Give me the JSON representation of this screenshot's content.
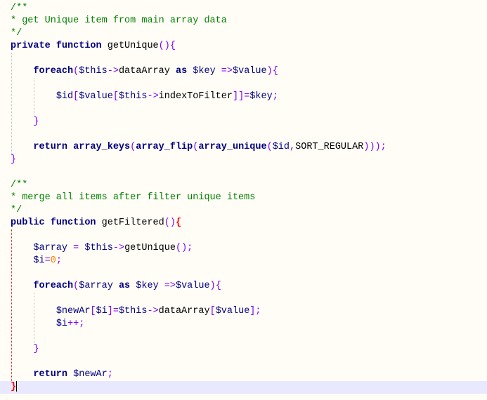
{
  "colors": {
    "background": "#fffdf6",
    "comment": "#008000",
    "keyword": "#000080",
    "operator": "#8000ff",
    "number": "#ff8000",
    "brace_match": "#ff0000",
    "current_line": "#e8e8ff"
  },
  "current_line": 30,
  "lines": [
    [
      [
        "c",
        "/**"
      ]
    ],
    [
      [
        "c",
        "* get Unique item from main array data"
      ]
    ],
    [
      [
        "c",
        "*/"
      ]
    ],
    [
      [
        "k",
        "private"
      ],
      [
        "f",
        " "
      ],
      [
        "k",
        "function"
      ],
      [
        "f",
        " getUnique"
      ],
      [
        "o",
        "(){"
      ]
    ],
    [],
    [
      [
        "f",
        "    "
      ],
      [
        "k",
        "foreach"
      ],
      [
        "o",
        "("
      ],
      [
        "v",
        "$this"
      ],
      [
        "o",
        "->"
      ],
      [
        "f",
        "dataArray "
      ],
      [
        "k",
        "as"
      ],
      [
        "f",
        " "
      ],
      [
        "v",
        "$key"
      ],
      [
        "f",
        " "
      ],
      [
        "o",
        "=>"
      ],
      [
        "v",
        "$value"
      ],
      [
        "o",
        "){"
      ]
    ],
    [],
    [
      [
        "f",
        "        "
      ],
      [
        "v",
        "$id"
      ],
      [
        "o",
        "["
      ],
      [
        "v",
        "$value"
      ],
      [
        "o",
        "["
      ],
      [
        "v",
        "$this"
      ],
      [
        "o",
        "->"
      ],
      [
        "f",
        "indexToFilter"
      ],
      [
        "o",
        "]]="
      ],
      [
        "v",
        "$key"
      ],
      [
        "o",
        ";"
      ]
    ],
    [],
    [
      [
        "f",
        "    "
      ],
      [
        "o",
        "}"
      ]
    ],
    [],
    [
      [
        "f",
        "    "
      ],
      [
        "k",
        "return"
      ],
      [
        "f",
        " "
      ],
      [
        "k",
        "array_keys"
      ],
      [
        "o",
        "("
      ],
      [
        "k",
        "array_flip"
      ],
      [
        "o",
        "("
      ],
      [
        "k",
        "array_unique"
      ],
      [
        "o",
        "("
      ],
      [
        "v",
        "$id"
      ],
      [
        "o",
        ","
      ],
      [
        "f",
        "SORT_REGULAR"
      ],
      [
        "o",
        ")));"
      ]
    ],
    [
      [
        "o",
        "}"
      ]
    ],
    [],
    [
      [
        "c",
        "/**"
      ]
    ],
    [
      [
        "c",
        "* merge all items after filter unique items"
      ]
    ],
    [
      [
        "c",
        "*/"
      ]
    ],
    [
      [
        "k",
        "public"
      ],
      [
        "f",
        " "
      ],
      [
        "k",
        "function"
      ],
      [
        "f",
        " getFiltered"
      ],
      [
        "o",
        "()"
      ],
      [
        "b",
        "{"
      ]
    ],
    [],
    [
      [
        "f",
        "    "
      ],
      [
        "v",
        "$array"
      ],
      [
        "f",
        " "
      ],
      [
        "o",
        "="
      ],
      [
        "f",
        " "
      ],
      [
        "v",
        "$this"
      ],
      [
        "o",
        "->"
      ],
      [
        "f",
        "getUnique"
      ],
      [
        "o",
        "();"
      ]
    ],
    [
      [
        "f",
        "    "
      ],
      [
        "v",
        "$i"
      ],
      [
        "o",
        "="
      ],
      [
        "n",
        "0"
      ],
      [
        "o",
        ";"
      ]
    ],
    [],
    [
      [
        "f",
        "    "
      ],
      [
        "k",
        "foreach"
      ],
      [
        "o",
        "("
      ],
      [
        "v",
        "$array"
      ],
      [
        "f",
        " "
      ],
      [
        "k",
        "as"
      ],
      [
        "f",
        " "
      ],
      [
        "v",
        "$key"
      ],
      [
        "f",
        " "
      ],
      [
        "o",
        "=>"
      ],
      [
        "v",
        "$value"
      ],
      [
        "o",
        "){"
      ]
    ],
    [],
    [
      [
        "f",
        "        "
      ],
      [
        "v",
        "$newAr"
      ],
      [
        "o",
        "["
      ],
      [
        "v",
        "$i"
      ],
      [
        "o",
        "]="
      ],
      [
        "v",
        "$this"
      ],
      [
        "o",
        "->"
      ],
      [
        "f",
        "dataArray"
      ],
      [
        "o",
        "["
      ],
      [
        "v",
        "$value"
      ],
      [
        "o",
        "];"
      ]
    ],
    [
      [
        "f",
        "        "
      ],
      [
        "v",
        "$i"
      ],
      [
        "o",
        "++;"
      ]
    ],
    [],
    [
      [
        "f",
        "    "
      ],
      [
        "o",
        "}"
      ]
    ],
    [],
    [
      [
        "f",
        "    "
      ],
      [
        "k",
        "return"
      ],
      [
        "f",
        " "
      ],
      [
        "v",
        "$newAr"
      ],
      [
        "o",
        ";"
      ]
    ],
    [
      [
        "b",
        "}"
      ]
    ]
  ]
}
